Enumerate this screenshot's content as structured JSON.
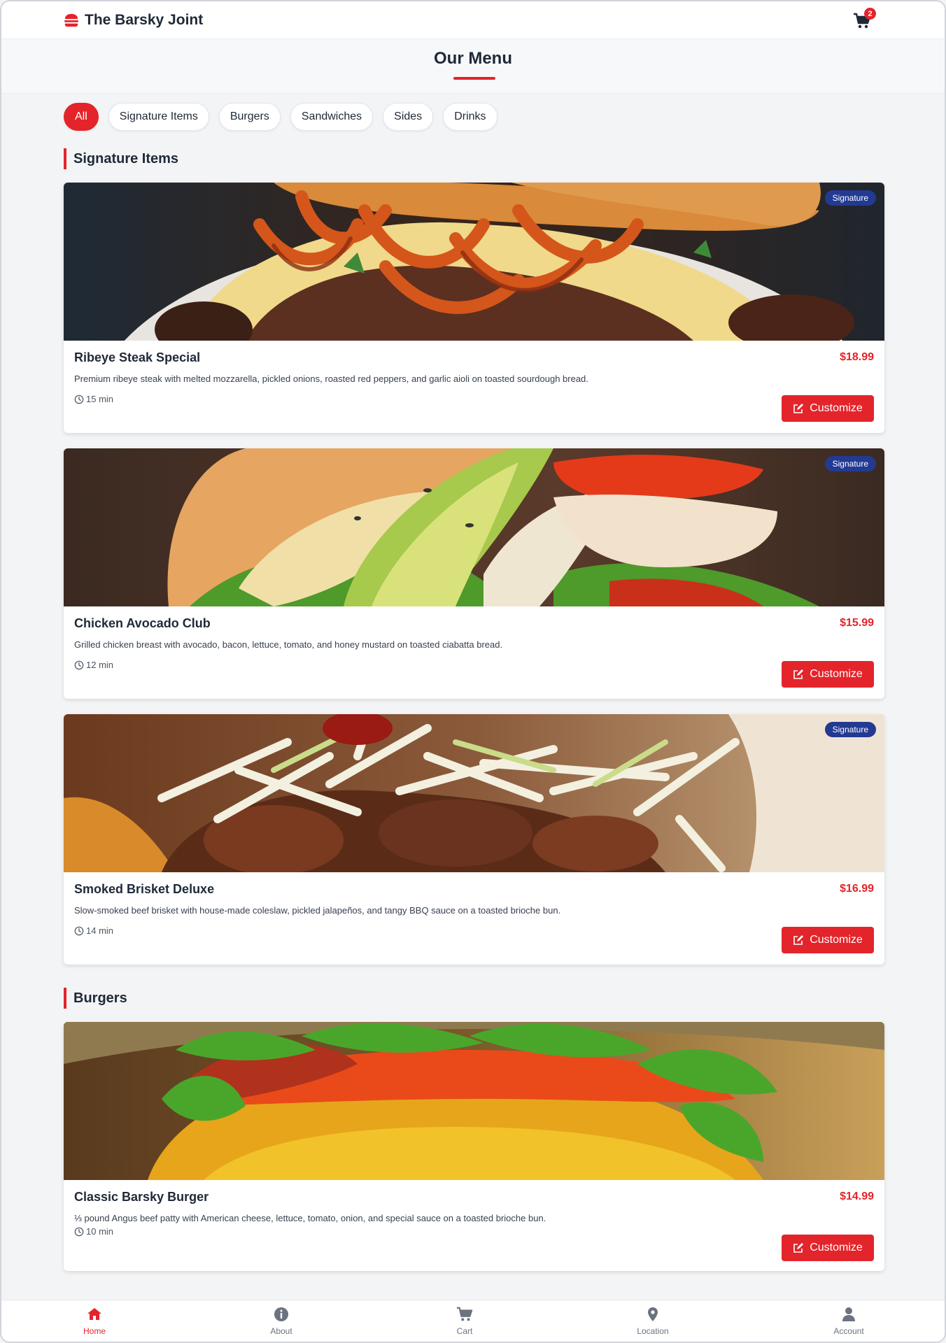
{
  "header": {
    "brand": "The Barsky Joint",
    "brand_icon": "burger-icon",
    "cart_icon": "cart-icon",
    "cart_count": "2"
  },
  "page": {
    "title": "Our Menu"
  },
  "filters": [
    {
      "label": "All",
      "active": true
    },
    {
      "label": "Signature Items",
      "active": false
    },
    {
      "label": "Burgers",
      "active": false
    },
    {
      "label": "Sandwiches",
      "active": false
    },
    {
      "label": "Sides",
      "active": false
    },
    {
      "label": "Drinks",
      "active": false
    }
  ],
  "sections": [
    {
      "title": "Signature Items",
      "items": [
        {
          "name": "Ribeye Steak Special",
          "price": "$18.99",
          "badge": "Signature",
          "description": "Premium ribeye steak with melted mozzarella, pickled onions, roasted red peppers, and garlic aioli on toasted sourdough bread.",
          "time": "15 min",
          "action": "Customize"
        },
        {
          "name": "Chicken Avocado Club",
          "price": "$15.99",
          "badge": "Signature",
          "description": "Grilled chicken breast with avocado, bacon, lettuce, tomato, and honey mustard on toasted ciabatta bread.",
          "time": "12 min",
          "action": "Customize"
        },
        {
          "name": "Smoked Brisket Deluxe",
          "price": "$16.99",
          "badge": "Signature",
          "description": "Slow-smoked beef brisket with house-made coleslaw, pickled jalapeños, and tangy BBQ sauce on a toasted brioche bun.",
          "time": "14 min",
          "action": "Customize"
        }
      ]
    },
    {
      "title": "Burgers",
      "items": [
        {
          "name": "Classic Barsky Burger",
          "price": "$14.99",
          "description": "⅓ pound Angus beef patty with American cheese, lettuce, tomato, onion, and special sauce on a toasted brioche bun.",
          "time": "10 min",
          "action": "Customize"
        }
      ]
    }
  ],
  "bottom_nav": [
    {
      "label": "Home",
      "icon": "home-icon",
      "active": true
    },
    {
      "label": "About",
      "icon": "info-icon",
      "active": false
    },
    {
      "label": "Cart",
      "icon": "cart-icon",
      "active": false
    },
    {
      "label": "Location",
      "icon": "location-pin-icon",
      "active": false
    },
    {
      "label": "Account",
      "icon": "user-icon",
      "active": false
    }
  ],
  "colors": {
    "accent": "#e3242b",
    "badge": "#233a92",
    "background": "#f3f4f6"
  }
}
